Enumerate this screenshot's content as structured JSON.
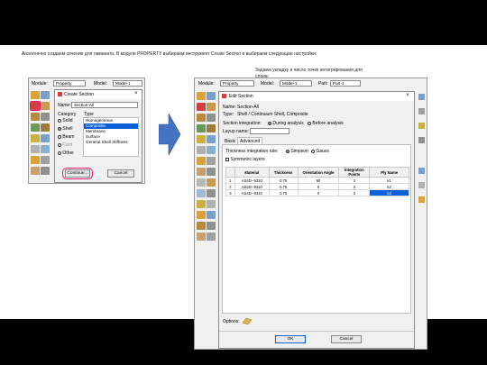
{
  "caption_left": "Аналогично создаем сечение для ламината. В модуле PROPERTY выбираем инструмент Create Section и выбираем следующие настройки:",
  "caption_right": "Задаем укладку и число точек интегрирования для слоев:",
  "left": {
    "module_label": "Module:",
    "module_value": "Property",
    "model_label": "Model:",
    "model_value": "Model-1",
    "dialog_title": "Create Section",
    "name_label": "Name:",
    "name_value": "Section-All",
    "category_label": "Category",
    "type_label": "Type",
    "categories": [
      "Solid",
      "Shell",
      "Beam",
      "Fluid",
      "Other"
    ],
    "types": [
      "Homogeneous",
      "Composite",
      "Membrane",
      "Surface",
      "General Shell Stiffness"
    ],
    "continue_label": "Continue...",
    "cancel_label": "Cancel"
  },
  "right": {
    "module_label": "Module:",
    "module_value": "Property",
    "model_label": "Model:",
    "model_value": "Model-1",
    "part_label": "Part:",
    "part_value": "Part-1",
    "dialog_title": "Edit Section",
    "name_label": "Name:",
    "name_value": "Section-All",
    "type_label": "Type:",
    "type_value": "Shell / Continuum Shell, Composite",
    "integration_label": "Section integration:",
    "during_label": "During analysis",
    "before_label": "Before analysis",
    "layup_label": "Layup name:",
    "tab_basic": "Basic",
    "tab_advanced": "Advanced",
    "thickness_rule_label": "Thickness integration rule:",
    "simpson_label": "Simpson",
    "gauss_label": "Gauss",
    "symmetric_label": "Symmetric layers",
    "table_headers": [
      "Material",
      "Thickness",
      "Orientation Angle",
      "Integration Points",
      "Ply Name"
    ],
    "rows": [
      [
        "AS4D--9310",
        "0.75",
        "90",
        "3",
        "k1"
      ],
      [
        "AS4D--9310",
        "0.75",
        "0",
        "3",
        "k2"
      ],
      [
        "AS4D--9310",
        "0.75",
        "0",
        "3",
        "k3"
      ]
    ],
    "options_label": "Options:",
    "ok_label": "OK",
    "cancel_label": "Cancel"
  },
  "colors": {
    "arrow": "#4472c4",
    "highlight_ring": "#e8196a",
    "selection": "#0a5fd6"
  }
}
